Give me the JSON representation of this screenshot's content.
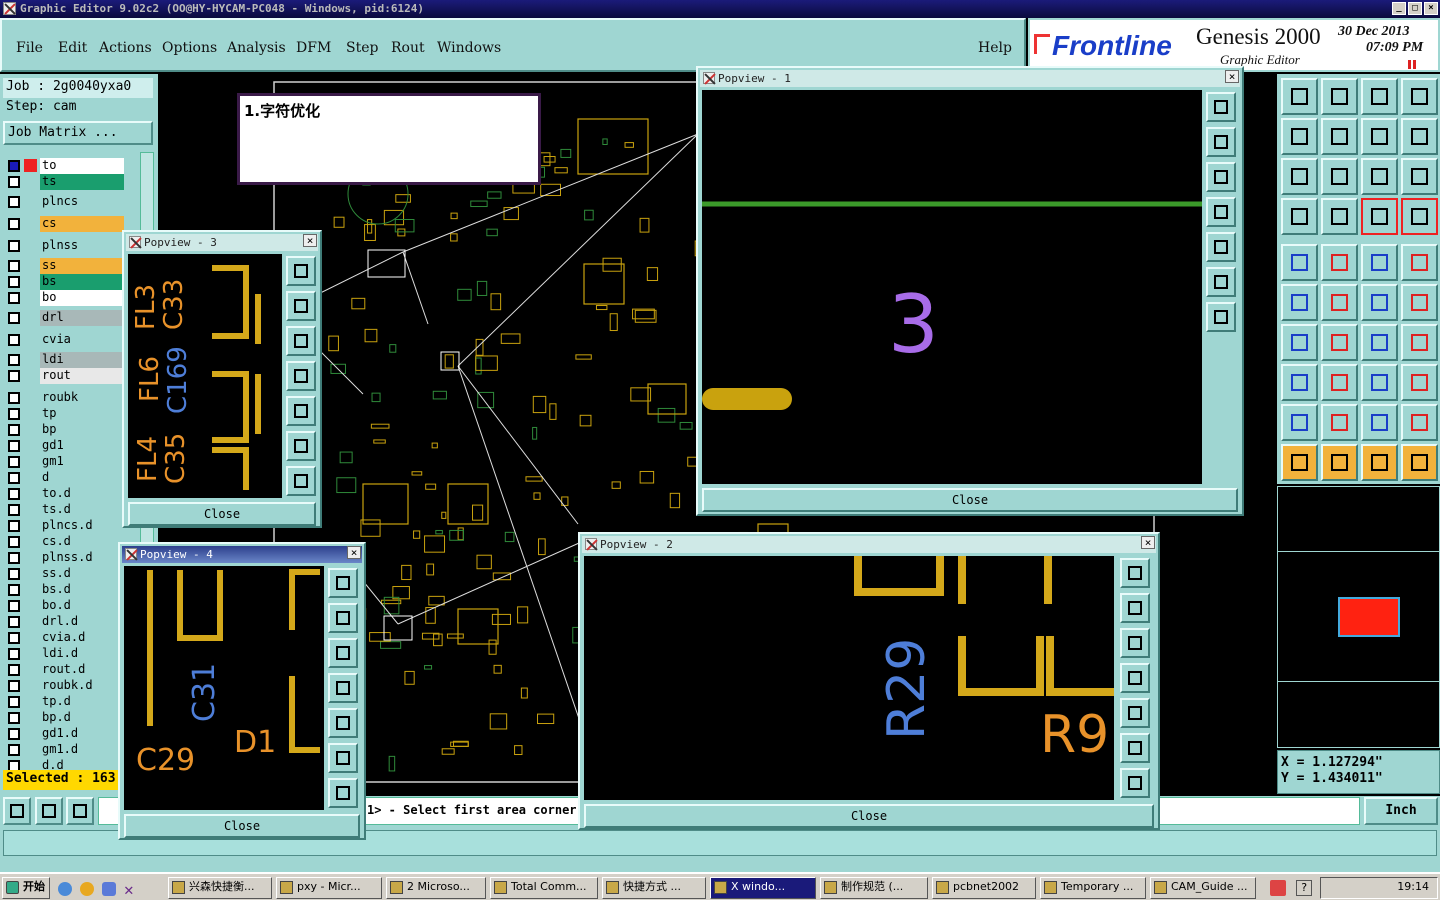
{
  "app": {
    "title": "Graphic Editor 9.02c2 (OO@HY-HYCAM-PC048 - Windows, pid:6124)"
  },
  "menu": [
    "File",
    "Edit",
    "Actions",
    "Options",
    "Analysis",
    "DFM",
    "Step",
    "Rout",
    "Windows"
  ],
  "help_label": "Help",
  "brand": {
    "logo": "Frontline",
    "product": "Genesis 2000",
    "subtitle": "Graphic Editor",
    "date": "30 Dec 2013",
    "time": "07:09 PM"
  },
  "job": {
    "job_label": "Job : 2g0040yxa0",
    "step_label": "Step: cam",
    "matrix_button": "Job Matrix ..."
  },
  "layers": [
    {
      "name": "to",
      "color": "#ffffff",
      "editable": true
    },
    {
      "name": "ts",
      "color": "#1a9e6e",
      "editable": true
    },
    {
      "name": "plncs",
      "color": "#9fd6d2",
      "editable": false
    },
    {
      "name": "cs",
      "color": "#f2b23c",
      "editable": true
    },
    {
      "name": "plnss",
      "color": "#9fd6d2",
      "editable": false
    },
    {
      "name": "ss",
      "color": "#f2b23c",
      "editable": true
    },
    {
      "name": "bs",
      "color": "#1a9e6e",
      "editable": true
    },
    {
      "name": "bo",
      "color": "#ffffff",
      "editable": true
    },
    {
      "name": "drl",
      "color": "#a8b8b8",
      "editable": false
    },
    {
      "name": "cvia",
      "color": "#9fd6d2",
      "editable": false
    },
    {
      "name": "ldi",
      "color": "#a8b8b8",
      "editable": false
    },
    {
      "name": "rout",
      "color": "#e8e8e8",
      "editable": false
    },
    {
      "name": "roubk",
      "color": "#9fd6d2",
      "editable": false
    },
    {
      "name": "tp",
      "color": "#9fd6d2",
      "editable": false
    },
    {
      "name": "bp",
      "color": "#9fd6d2",
      "editable": false
    },
    {
      "name": "gd1",
      "color": "#9fd6d2",
      "editable": true
    },
    {
      "name": "gm1",
      "color": "#9fd6d2",
      "editable": true
    },
    {
      "name": "d",
      "color": "#9fd6d2",
      "editable": false
    },
    {
      "name": "to.d",
      "color": "#9fd6d2",
      "editable": true
    },
    {
      "name": "ts.d",
      "color": "#9fd6d2",
      "editable": true
    },
    {
      "name": "plncs.d",
      "color": "#9fd6d2",
      "editable": false
    },
    {
      "name": "cs.d",
      "color": "#9fd6d2",
      "editable": true
    },
    {
      "name": "plnss.d",
      "color": "#9fd6d2",
      "editable": false
    },
    {
      "name": "ss.d",
      "color": "#9fd6d2",
      "editable": true
    },
    {
      "name": "bs.d",
      "color": "#9fd6d2",
      "editable": true
    },
    {
      "name": "bo.d",
      "color": "#9fd6d2",
      "editable": true
    },
    {
      "name": "drl.d",
      "color": "#9fd6d2",
      "editable": true
    },
    {
      "name": "cvia.d",
      "color": "#9fd6d2",
      "editable": true
    },
    {
      "name": "ldi.d",
      "color": "#9fd6d2",
      "editable": true
    },
    {
      "name": "rout.d",
      "color": "#9fd6d2",
      "editable": true
    },
    {
      "name": "roubk.d",
      "color": "#9fd6d2",
      "editable": true
    },
    {
      "name": "tp.d",
      "color": "#9fd6d2",
      "editable": true
    },
    {
      "name": "bp.d",
      "color": "#9fd6d2",
      "editable": true
    },
    {
      "name": "gd1.d",
      "color": "#9fd6d2",
      "editable": true
    },
    {
      "name": "gm1.d",
      "color": "#9fd6d2",
      "editable": true
    },
    {
      "name": "d.d",
      "color": "#9fd6d2",
      "editable": false
    }
  ],
  "selected": "Selected : 163",
  "note": "1.字符优化",
  "popviews": {
    "p1": {
      "title": "Popview - 1",
      "text": "3",
      "close": "Close"
    },
    "p2": {
      "title": "Popview - 2",
      "text1": "R29",
      "text2": "R9",
      "close": "Close"
    },
    "p3": {
      "title": "Popview - 3",
      "labels": [
        "FL3",
        "C33",
        "FL6",
        "C169",
        "FL4",
        "C35"
      ],
      "close": "Close"
    },
    "p4": {
      "title": "Popview - 4",
      "labels": [
        "C31",
        "C29",
        "D1"
      ],
      "close": "Close"
    }
  },
  "status": {
    "prompt": "1> - Select first area corner",
    "coord_x": "X = 1.127294\"",
    "coord_y": "Y = 1.434011\"",
    "units": "Inch"
  },
  "taskbar": {
    "start": "开始",
    "tasks": [
      "兴森快捷衡...",
      "pxy - Micr...",
      "2 Microso...",
      "Total Comm...",
      "快捷方式 ...",
      "X windo...",
      "制作规范 (...",
      "pcbnet2002",
      "Temporary ...",
      "CAM_Guide ..."
    ],
    "clock": "19:14"
  }
}
